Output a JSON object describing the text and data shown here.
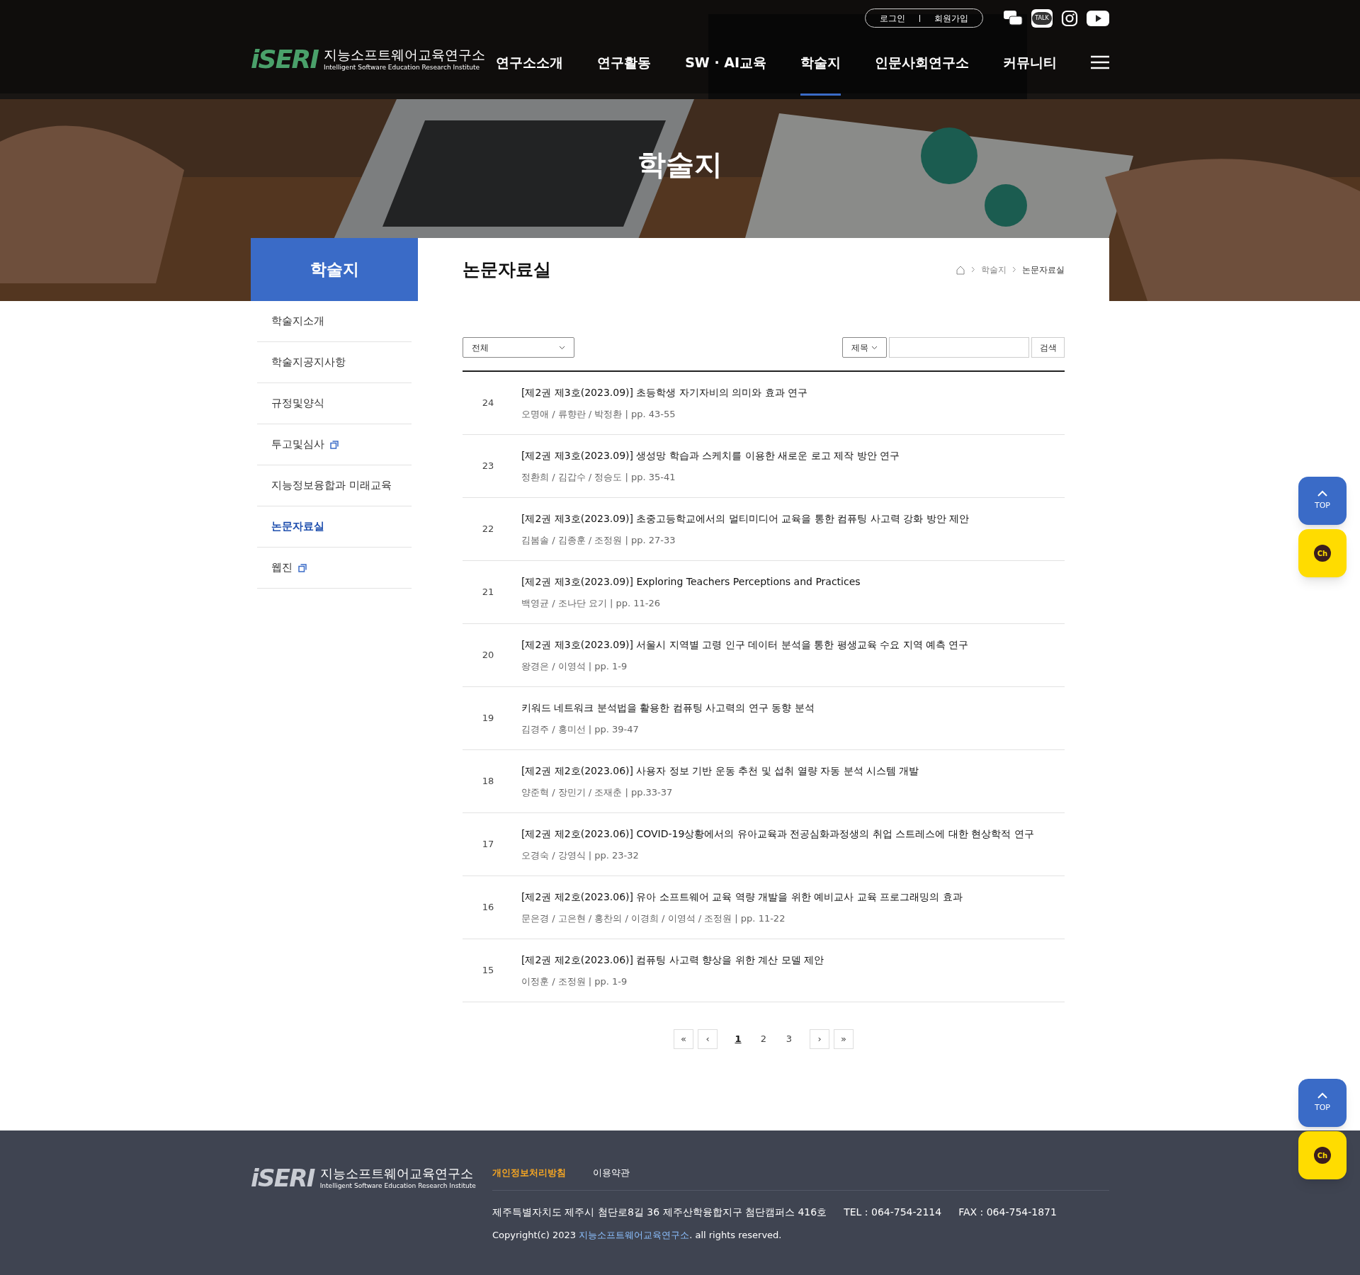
{
  "header": {
    "logo_mark": "iSERI",
    "logo_title": "지능소프트웨어교육연구소",
    "logo_subtitle": "Intelligent Software Education Research Institute",
    "auth_links": [
      "로그인",
      "회원가입"
    ],
    "kakao_label": "TALK",
    "nav": [
      {
        "label": "연구소소개",
        "selected": false
      },
      {
        "label": "연구활동",
        "selected": false
      },
      {
        "label": "SW · AI교육",
        "selected": false
      },
      {
        "label": "학술지",
        "selected": true
      },
      {
        "label": "인문사회연구소",
        "selected": false
      },
      {
        "label": "커뮤니티",
        "selected": false
      }
    ]
  },
  "hero": {
    "title": "학술지"
  },
  "sidebar": {
    "title": "학술지",
    "items": [
      {
        "label": "학술지소개",
        "selected": false,
        "external": false
      },
      {
        "label": "학술지공지사항",
        "selected": false,
        "external": false
      },
      {
        "label": "규정및양식",
        "selected": false,
        "external": false
      },
      {
        "label": "투고및심사",
        "selected": false,
        "external": true
      },
      {
        "label": "지능정보융합과 미래교육",
        "selected": false,
        "external": false
      },
      {
        "label": "논문자료실",
        "selected": true,
        "external": false
      },
      {
        "label": "웹진",
        "selected": false,
        "external": true
      }
    ]
  },
  "page": {
    "title": "논문자료실",
    "breadcrumb": [
      "학술지",
      "논문자료실"
    ]
  },
  "filters": {
    "category": "전체",
    "search_field": "제목",
    "search_button": "검색"
  },
  "papers": [
    {
      "number": "24",
      "title": "[제2권 제3호(2023.09)] 초등학생 자기자비의 의미와 효과 연구",
      "authors": "오명애 / 류향란 / 박정환 | pp. 43-55"
    },
    {
      "number": "23",
      "title": "[제2권 제3호(2023.09)] 생성망 학습과 스케치를 이용한 새로운 로고 제작 방안 연구",
      "authors": "정환희 / 김갑수 / 정승도 | pp. 35-41"
    },
    {
      "number": "22",
      "title": "[제2권 제3호(2023.09)] 초중고등학교에서의 멀티미디어 교육을 통한 컴퓨팅 사고력 강화 방안 제안",
      "authors": "김봄솔 / 김종훈 / 조정원 | pp. 27-33"
    },
    {
      "number": "21",
      "title": "[제2권 제3호(2023.09)] Exploring Teachers Perceptions and Practices",
      "authors": "백영균 / 조나단 요기 | pp. 11-26"
    },
    {
      "number": "20",
      "title": "[제2권 제3호(2023.09)] 서울시 지역별 고령 인구 데이터 분석을 통한 평생교육 수요 지역 예측 연구",
      "authors": "왕경은 / 이영석 | pp. 1-9"
    },
    {
      "number": "19",
      "title": "키워드 네트워크 분석법을 활용한 컴퓨팅 사고력의 연구 동향 분석",
      "authors": "김경주 / 홍미선 | pp. 39-47"
    },
    {
      "number": "18",
      "title": "[제2권 제2호(2023.06)] 사용자 정보 기반 운동 추천 및 섭취 열량 자동 분석 시스템 개발",
      "authors": "양준혁 / 장민기 / 조재춘 | pp.33-37"
    },
    {
      "number": "17",
      "title": "[제2권 제2호(2023.06)] COVID-19상황에서의 유아교육과 전공심화과정생의 취업 스트레스에 대한 현상학적 연구",
      "authors": "오경숙 / 강영식 | pp. 23-32"
    },
    {
      "number": "16",
      "title": "[제2권 제2호(2023.06)] 유아 소프트웨어 교육 역량 개발을 위한 예비교사 교육 프로그래밍의 효과",
      "authors": "문은경 / 고은현 / 홍찬의 / 이경희 / 이영석 / 조정원 | pp. 11-22"
    },
    {
      "number": "15",
      "title": "[제2권 제2호(2023.06)] 컴퓨팅 사고력 향상을 위한 계산 모델 제안",
      "authors": "이정훈 / 조정원 | pp. 1-9"
    }
  ],
  "pagination": {
    "first": "«",
    "prev": "‹",
    "pages": [
      {
        "label": "1",
        "selected": true
      },
      {
        "label": "2",
        "selected": false
      },
      {
        "label": "3",
        "selected": false
      }
    ],
    "next": "›",
    "last": "»"
  },
  "floating": [
    {
      "top_label": "TOP",
      "chat_label": "Ch"
    },
    {
      "top_label": "TOP",
      "chat_label": "Ch"
    }
  ],
  "footer": {
    "logo_mark": "iSERI",
    "logo_title": "지능소프트웨어교육연구소",
    "logo_subtitle": "Intelligent Software Education Research Institute",
    "links": [
      {
        "label": "개인정보처리방침",
        "highlight": true
      },
      {
        "label": "이용약관",
        "highlight": false
      }
    ],
    "address": "제주특별자치도 제주시 첨단로8길 36 제주산학융합지구 첨단캠퍼스 416호",
    "tel": "TEL : 064-754-2114",
    "fax": "FAX : 064-754-1871",
    "copyright_prefix": "Copyright(c) 2023",
    "copyright_name": "지능소프트웨어교육연구소",
    "copyright_suffix": ". all rights reserved."
  }
}
